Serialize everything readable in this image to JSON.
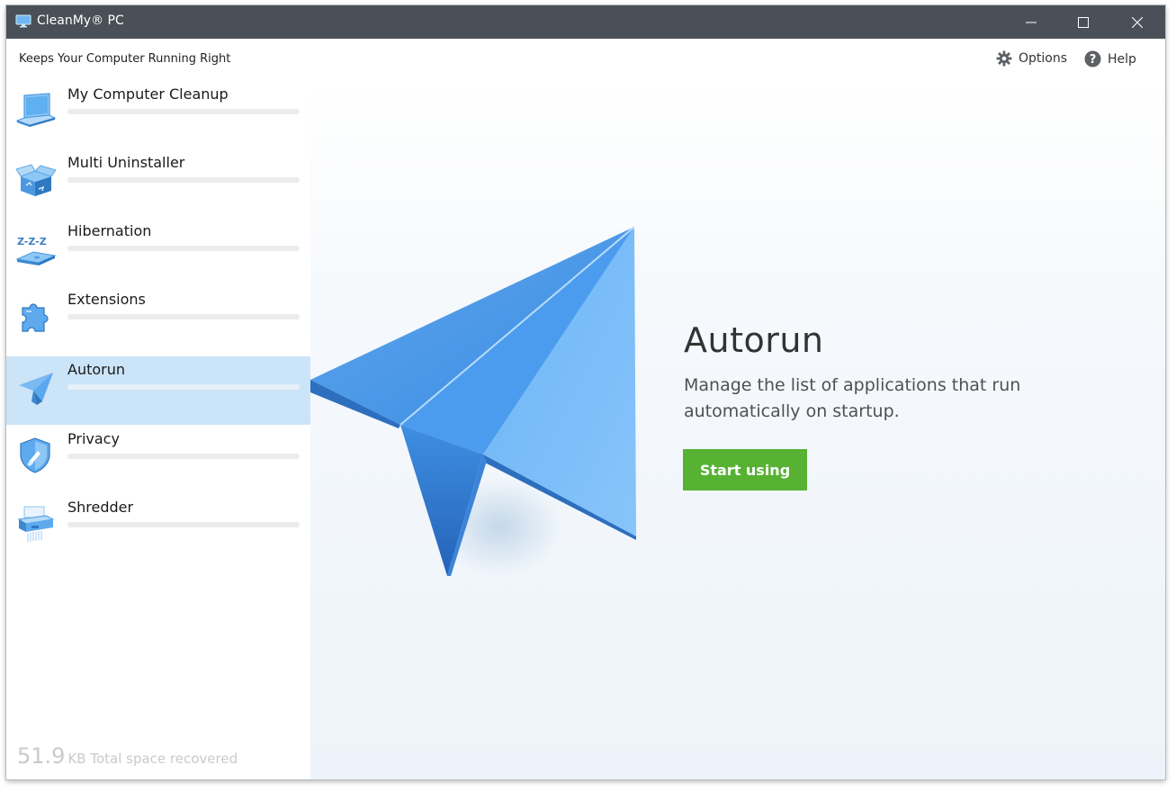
{
  "window": {
    "title": "CleanMy® PC",
    "subtitle": "Keeps Your Computer Running Right"
  },
  "header": {
    "options_label": "Options",
    "help_label": "Help"
  },
  "sidebar": {
    "items": [
      {
        "label": "My Computer Cleanup",
        "icon": "laptop-icon",
        "active": false
      },
      {
        "label": "Multi Uninstaller",
        "icon": "box-icon",
        "active": false
      },
      {
        "label": "Hibernation",
        "icon": "hibernation-icon",
        "active": false
      },
      {
        "label": "Extensions",
        "icon": "puzzle-icon",
        "active": false
      },
      {
        "label": "Autorun",
        "icon": "paper-plane-icon",
        "active": true
      },
      {
        "label": "Privacy",
        "icon": "shield-icon",
        "active": false
      },
      {
        "label": "Shredder",
        "icon": "shredder-icon",
        "active": false
      }
    ],
    "footer": {
      "value": "51.9",
      "unit_label": "KB Total space recovered"
    }
  },
  "main": {
    "title": "Autorun",
    "description": "Manage the list of applications that run automatically on startup.",
    "button_label": "Start using"
  },
  "colors": {
    "titlebar": "#4a5057",
    "active_item": "#cce4f7",
    "accent_blue": "#4a9ff5",
    "button_green": "#57b233"
  }
}
